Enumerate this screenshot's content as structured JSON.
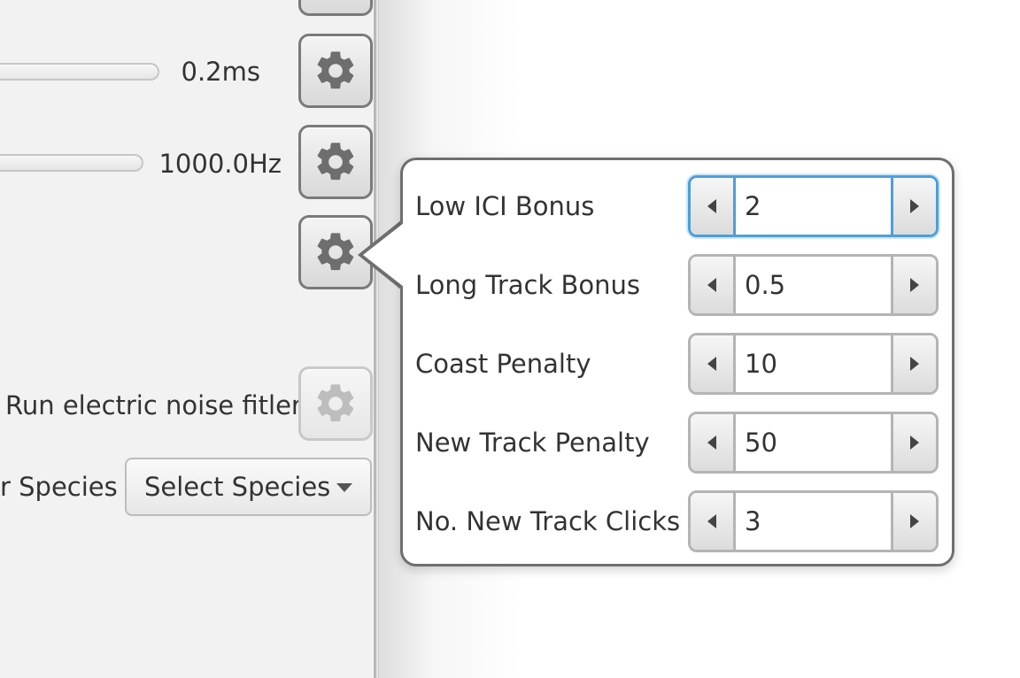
{
  "left_panel": {
    "slider_1_value": "0.2ms",
    "slider_2_value": "1000.0Hz",
    "noise_filter_label": "Run electric noise fitler",
    "species_label": "r Species",
    "species_select": "Select Species"
  },
  "icons": {
    "gear": "gear-icon",
    "spinner_decrement": "triangle-left-icon",
    "spinner_increment": "triangle-right-icon",
    "dropdown": "chevron-down-icon"
  },
  "colors": {
    "focus_accent": "#4d9fd8",
    "gear_icon": "#6e6e6e",
    "gear_icon_disabled": "#bdbdbd",
    "popup_border": "#6f6f6f"
  },
  "popup": {
    "rows": [
      {
        "label": "Low ICI Bonus",
        "value": "2",
        "focused": true
      },
      {
        "label": "Long Track Bonus",
        "value": "0.5",
        "focused": false
      },
      {
        "label": "Coast Penalty",
        "value": "10",
        "focused": false
      },
      {
        "label": "New Track Penalty",
        "value": "50",
        "focused": false
      },
      {
        "label": "No. New Track Clicks",
        "value": "3",
        "focused": false
      }
    ]
  }
}
